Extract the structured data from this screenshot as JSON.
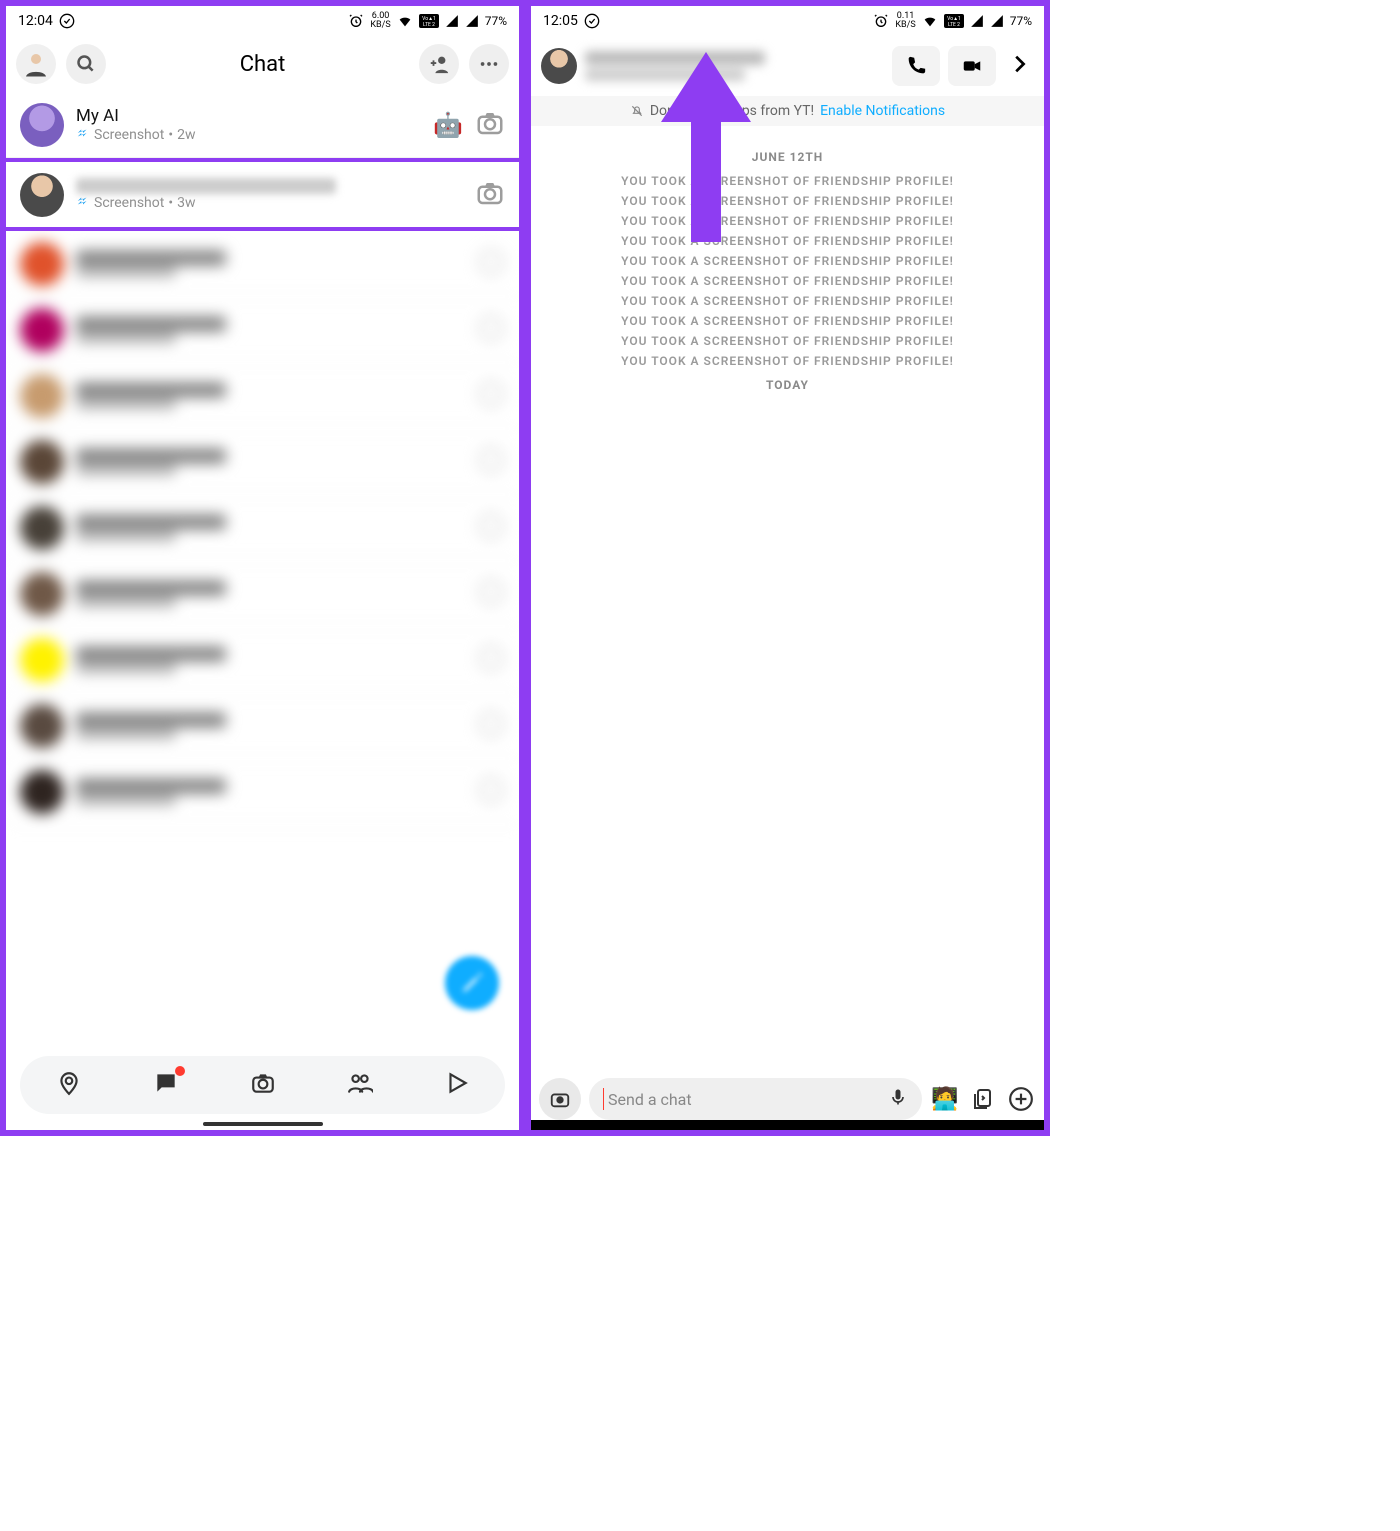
{
  "left": {
    "status": {
      "time": "12:04",
      "net": "6.00",
      "netunit": "KB/S",
      "battery": "77%"
    },
    "title": "Chat",
    "rows": [
      {
        "name": "My AI",
        "status": "Screenshot",
        "time": "2w",
        "emoji": "🤖",
        "avatar_bg": "#d2c6ea"
      },
      {
        "name": "",
        "status": "Screenshot",
        "time": "3w"
      }
    ],
    "blurred_rows": [
      {
        "avatar_bg": "#e0522b"
      },
      {
        "avatar_bg": "#b0005e"
      },
      {
        "avatar_bg": "#c79b6e"
      },
      {
        "avatar_bg": "#5a4637"
      },
      {
        "avatar_bg": "#474038"
      },
      {
        "avatar_bg": "#6f5847"
      },
      {
        "avatar_bg": "#fff200"
      },
      {
        "avatar_bg": "#594a40"
      },
      {
        "avatar_bg": "#2e2420"
      }
    ]
  },
  "right": {
    "status": {
      "time": "12:05",
      "net": "0.11",
      "netunit": "KB/S",
      "battery": "77%"
    },
    "notice": {
      "text": "Don't miss Snaps from YT!",
      "link": "Enable Notifications"
    },
    "date1": "JUNE 12TH",
    "sys_msg": "YOU TOOK A SCREENSHOT OF FRIENDSHIP PROFILE!",
    "sys_count": 10,
    "date2": "TODAY",
    "input_placeholder": "Send a chat"
  }
}
